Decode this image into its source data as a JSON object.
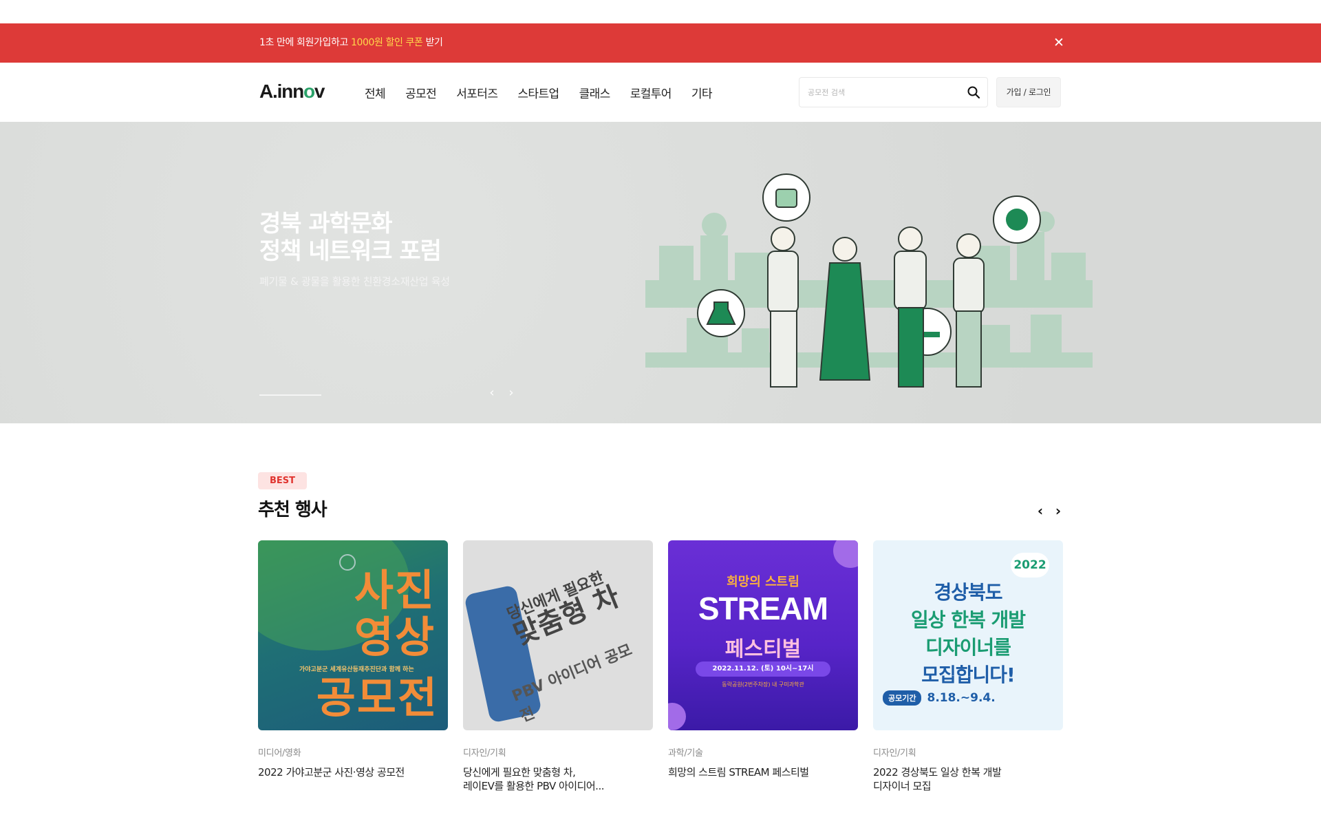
{
  "promo": {
    "text_before": "1초 만에 회원가입하고 ",
    "highlight": "1000원 할인 쿠폰",
    "text_after": " 받기",
    "close_icon": "close-icon",
    "bg_color": "#dd3a38",
    "highlight_color": "#ffd84a"
  },
  "header": {
    "logo": {
      "part1": "A.inn",
      "part2": "o",
      "part3": "v"
    },
    "nav": [
      "전체",
      "공모전",
      "서포터즈",
      "스타트업",
      "클래스",
      "로컬투어",
      "기타"
    ],
    "search": {
      "placeholder": "공모전 검색",
      "icon": "search-icon"
    },
    "login_label": "가입 / 로그인"
  },
  "hero": {
    "title_line1": "경북 과학문화",
    "title_line2": "정책 네트워크 포럼",
    "subtitle": "폐기물 & 광물을 활용한 친환경소재산업 육성",
    "prev_icon": "chevron-left-icon",
    "next_icon": "chevron-right-icon",
    "accent_color": "#2ba26a"
  },
  "best": {
    "badge": "BEST",
    "title": "추천 행사",
    "cards": [
      {
        "category": "미디어/영화",
        "title": "2022 가야고분군 사진·영상 공모전",
        "thumb": {
          "line1": "사진",
          "line2": "영상",
          "line3": "공모전",
          "small": "가야고분군 세계유산등재추진단과 함께 하는"
        }
      },
      {
        "category": "디자인/기획",
        "title": "당신에게 필요한 맞춤형 차,\n레이EV를 활용한 PBV 아이디어...",
        "thumb": {
          "line1": "당신에게 필요한",
          "line2": "맞춤형 차",
          "line3": "PBV 아이디어 공모전"
        }
      },
      {
        "category": "과학/기술",
        "title": "희망의 스트림 STREAM 페스티벌",
        "thumb": {
          "sub": "희망의 스트림",
          "main": "STREAM",
          "fest": "페스티벌",
          "date": "2022.11.12. (토) 10시~17시",
          "loc": "동락공원(2번주차장) 내 구미과학관"
        }
      },
      {
        "category": "디자인/기획",
        "title": "2022 경상북도 일상 한복 개발\n디자이너 모집",
        "thumb": {
          "badge": "2022",
          "l1": "경상북도",
          "l2": "일상 한복 개발",
          "l3": "디자이너를",
          "l4": "모집합니다!",
          "period_label": "공모기간",
          "period": "8.18.~9.4."
        }
      }
    ]
  }
}
